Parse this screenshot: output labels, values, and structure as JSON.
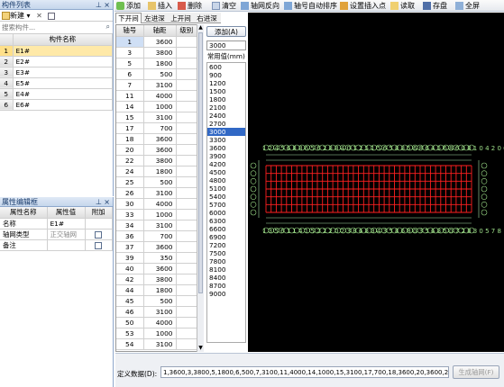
{
  "toolbar": {
    "add": "添加",
    "insert": "插入",
    "delete": "删除",
    "clear": "清空",
    "reverse": "轴网反向",
    "auto_sort": "轴号自动排序",
    "set_insert_point": "设置插入点",
    "read": "读取",
    "save": "存盘",
    "fullscreen": "全屏"
  },
  "component_list": {
    "title": "构件列表",
    "new_label": "新建",
    "search_placeholder": "搜索构件...",
    "header_name": "构件名称",
    "rows": [
      {
        "idx": "1",
        "name": "E1#"
      },
      {
        "idx": "2",
        "name": "E2#"
      },
      {
        "idx": "3",
        "name": "E3#"
      },
      {
        "idx": "4",
        "name": "E5#"
      },
      {
        "idx": "5",
        "name": "E4#"
      },
      {
        "idx": "6",
        "name": "E6#"
      }
    ]
  },
  "properties": {
    "title": "属性编辑框",
    "col_name": "属性名称",
    "col_value": "属性值",
    "col_extra": "附加",
    "rows": [
      {
        "name": "名称",
        "value": "E1#"
      },
      {
        "name": "轴网类型",
        "value": "正交轴网"
      },
      {
        "name": "备注",
        "value": ""
      }
    ]
  },
  "axis_tabs": [
    "下开间",
    "左进深",
    "上开间",
    "右进深"
  ],
  "axis_table": {
    "col_no": "轴号",
    "col_dist": "轴距",
    "col_level": "级别",
    "rows": [
      [
        "1",
        "3600"
      ],
      [
        "3",
        "3800"
      ],
      [
        "5",
        "1800"
      ],
      [
        "6",
        "500"
      ],
      [
        "7",
        "3100"
      ],
      [
        "11",
        "4000"
      ],
      [
        "14",
        "1000"
      ],
      [
        "15",
        "3100"
      ],
      [
        "17",
        "700"
      ],
      [
        "18",
        "3600"
      ],
      [
        "20",
        "3600"
      ],
      [
        "22",
        "3800"
      ],
      [
        "24",
        "1800"
      ],
      [
        "25",
        "500"
      ],
      [
        "26",
        "3100"
      ],
      [
        "30",
        "4000"
      ],
      [
        "33",
        "1000"
      ],
      [
        "34",
        "3100"
      ],
      [
        "36",
        "700"
      ],
      [
        "37",
        "3600"
      ],
      [
        "39",
        "350"
      ],
      [
        "40",
        "3600"
      ],
      [
        "42",
        "3800"
      ],
      [
        "44",
        "1800"
      ],
      [
        "45",
        "500"
      ],
      [
        "46",
        "3100"
      ],
      [
        "50",
        "4000"
      ],
      [
        "53",
        "1000"
      ],
      [
        "54",
        "3100"
      ]
    ]
  },
  "common_values": {
    "add_button": "添加(A)",
    "input_value": "3000",
    "label": "常用值(mm)",
    "items": [
      "600",
      "900",
      "1200",
      "1500",
      "1800",
      "2100",
      "2400",
      "2700",
      "3000",
      "3300",
      "3600",
      "3900",
      "4200",
      "4500",
      "4800",
      "5100",
      "5400",
      "5700",
      "6000",
      "6300",
      "6600",
      "6900",
      "7200",
      "7500",
      "7800",
      "8100",
      "8400",
      "8700",
      "9000"
    ],
    "selected": "3000"
  },
  "canvas": {
    "top_labels": "1 2 4 5 6 8 8 6 5 6 2 8 8 4 0 1 2 5 1 5 6 5 8 8 5 6 8 6 4 5 6 8 6 0 8 1 0 4 2 0 6 5 4 3 7 8",
    "bottom_labels": "1 3 5 6 1 1 4 1 5 2 2 2 0 2 3 8 6 8 3 4 3 5 8 6 8 0 3 5 6 8 5 0 7 2 8 3 0 5 7 8",
    "colors": {
      "bg": "#000000",
      "grid": "#ff2020",
      "bubble": "#9fe08a",
      "dim": "#a8e2a8"
    }
  },
  "status": {
    "label": "定义数据(D):",
    "value": "1,3600,3,3800,5,1800,6,500,7,3100,11,4000,14,1000,15,3100,17,700,18,3600,20,3600,22,3800,24",
    "generate_button": "生成轴网(F)"
  }
}
